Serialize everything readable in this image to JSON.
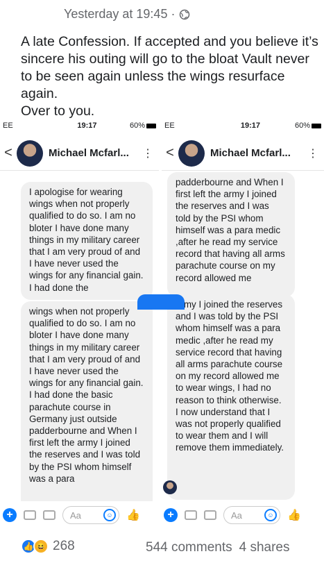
{
  "post": {
    "timestamp": "Yesterday at 19:45 ·",
    "audience_icon": "globe-icon",
    "text": "A late Confession. If accepted and you believe it’s sincere his outing will go to the bloat Vault never to be seen again unless the wings resurface again.\nOver to you."
  },
  "screenshots": {
    "left": {
      "carrier": "EE",
      "time": "19:17",
      "battery": "60%",
      "contact": "Michael Mcfarl...",
      "bubble1": "I apologise for wearing wings when not properly qualified to do so. I am no bloter I have done many things in my military career that I am very proud of and I have never used the wings for any financial gain. I had done the",
      "bubble2": "wings when not properly qualified to do so. I am no bloter I have done many things in my military career that I am very proud of and I have never used the wings for any financial gain. I had done the basic parachute course in Germany just outside padderbourne and When I first left the army I joined the reserves and I was told by the PSI whom himself was a para"
    },
    "right": {
      "carrier": "EE",
      "time": "19:17",
      "battery": "60%",
      "contact": "Michael Mcfarl...",
      "bubble1": "padderbourne and When I first left the army I joined the reserves and I was told by the PSI whom himself was a para medic ,after he read my service record that having all arms parachute course on my record allowed me",
      "bubble2": "army I joined the reserves and I was told by the PSI whom himself was a para medic ,after he read my service record that having all arms parachute course on my record allowed me to wear wings, I had no reason to think otherwise. I now understand that I was not properly qualified to wear them and I will remove them immediately."
    },
    "composer_placeholder": "Aa"
  },
  "footer": {
    "reaction_count": "268",
    "comments": "544 comments",
    "shares": "4 shares"
  },
  "colors": {
    "accent": "#1877f2",
    "bubble": "#f0f0f0"
  }
}
